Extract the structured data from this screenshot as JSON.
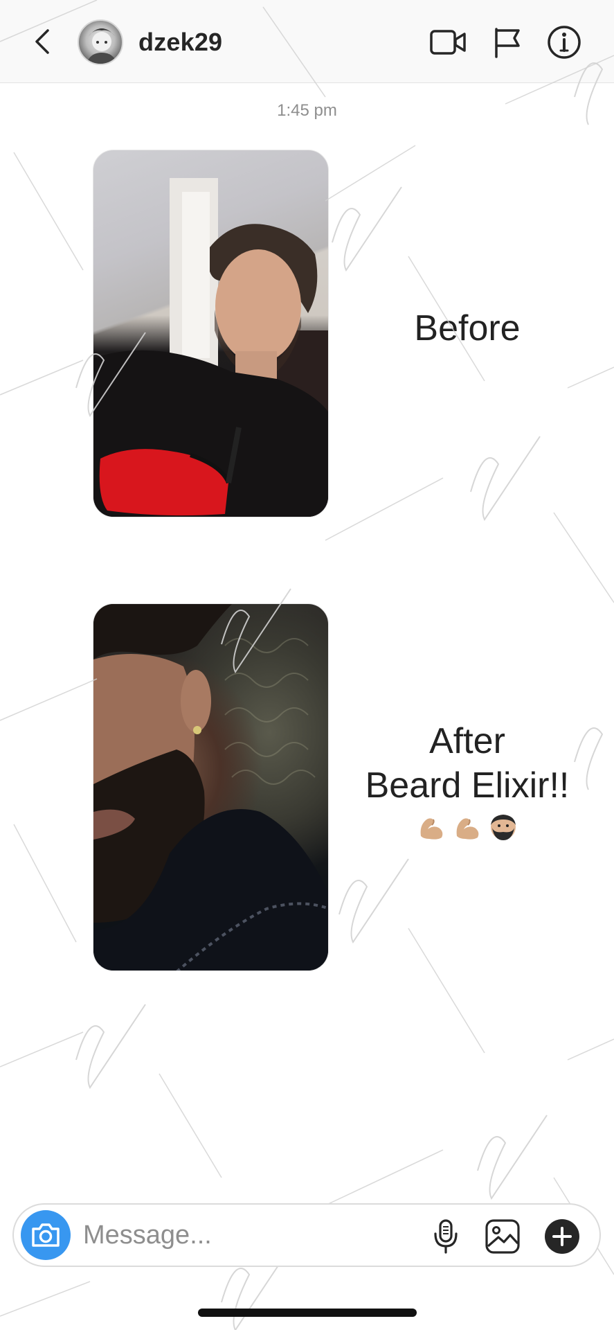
{
  "header": {
    "username": "dzek29",
    "icons": [
      "back-arrow",
      "avatar",
      "video-camera",
      "flag",
      "info"
    ]
  },
  "thread": {
    "timestamp": "1:45 pm",
    "messages": [
      {
        "type": "photo",
        "caption": "Before"
      },
      {
        "type": "photo",
        "caption_lines": [
          "After",
          "Beard Elixir!!"
        ],
        "emoji": [
          "flexed-biceps",
          "flexed-biceps",
          "bearded-man"
        ]
      }
    ]
  },
  "composer": {
    "placeholder": "Message...",
    "icons": [
      "camera",
      "microphone",
      "gallery",
      "plus"
    ]
  },
  "colors": {
    "accent": "#3897f0",
    "text": "#262626",
    "muted": "#8e8e8e",
    "border": "#dbdbdb"
  }
}
